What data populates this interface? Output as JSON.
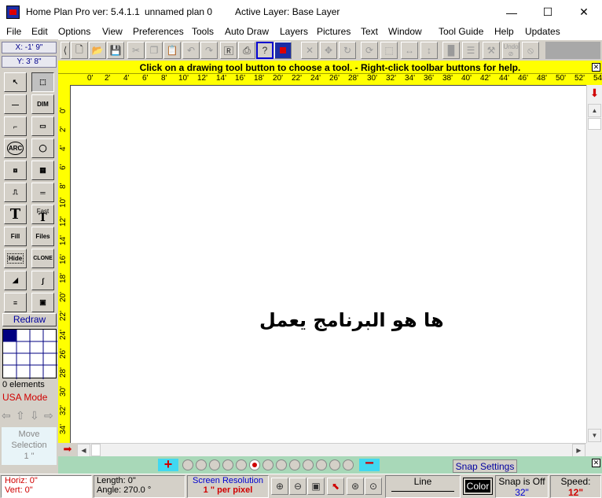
{
  "window": {
    "app_title": "Home Plan Pro ver: 5.4.1.1",
    "plan_name": "unnamed plan 0",
    "active_layer": "Active Layer: Base Layer",
    "minimize": "—",
    "maximize": "☐",
    "close": "✕"
  },
  "menu": [
    "File",
    "Edit",
    "Options",
    "View",
    "Preferences",
    "Tools",
    "Auto Draw",
    "Layers",
    "Pictures",
    "Text",
    "Window",
    "Tool Guide",
    "Help",
    "Updates"
  ],
  "coords": {
    "x": "X: -1' 9\"",
    "y": "Y: 3' 8\""
  },
  "banner": "Click on a drawing tool button to choose a tool.  -  Right-click toolbar buttons for help.",
  "ruler_h": [
    "0'",
    "2'",
    "4'",
    "6'",
    "8'",
    "10'",
    "12'",
    "14'",
    "16'",
    "18'",
    "20'",
    "22'",
    "24'",
    "26'",
    "28'",
    "30'",
    "32'",
    "34'",
    "36'",
    "38'",
    "40'",
    "42'",
    "44'",
    "46'",
    "48'",
    "50'",
    "52'",
    "54"
  ],
  "ruler_v": [
    "0'",
    "2'",
    "4'",
    "6'",
    "8'",
    "10'",
    "12'",
    "14'",
    "16'",
    "18'",
    "20'",
    "22'",
    "24'",
    "26'",
    "28'",
    "30'",
    "32'",
    "34'"
  ],
  "canvas_text": "ها هو البرنامج يعمل",
  "left_panel": {
    "dim": "DIM",
    "arc": "ARC",
    "fast": "Fast",
    "fill": "Fill",
    "files": "Files",
    "hide": "Hide",
    "clone": "CLONE",
    "redraw": "Redraw",
    "elements": "0 elements",
    "mode": "USA Mode",
    "move_selection": "Move Selection",
    "move_amount": "1 \""
  },
  "snap_settings": "Snap Settings",
  "undo_label": "Undo",
  "status": {
    "horiz": "Horiz: 0\"",
    "vert": "Vert:  0\"",
    "length": "Length:  0\"",
    "angle": "Angle:  270.0 °",
    "screen_res_label": "Screen Resolution",
    "screen_res_value": "1 \" per pixel",
    "line": "Line",
    "color": "Color",
    "snap_label": "Snap is Off",
    "snap_value": "32\"",
    "speed_label": "Speed:",
    "speed_value": "12\""
  },
  "colors": {
    "banner": "#ffff00",
    "ruler": "#ffff00",
    "accent_red": "#d00000",
    "navy": "#00008b",
    "layer_bar": "#a8d8b8"
  }
}
